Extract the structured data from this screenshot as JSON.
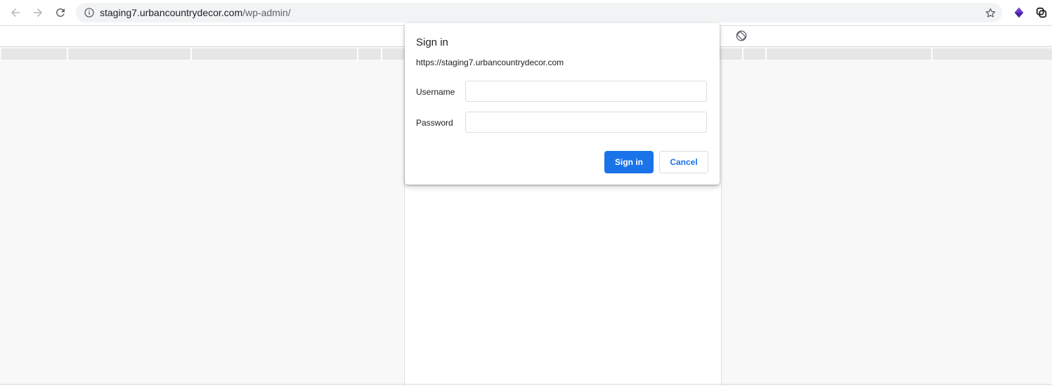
{
  "browser": {
    "url_host": "staging7.urbancountrydecor.com",
    "url_path": "/wp-admin/",
    "icons": {
      "back": "arrow-left",
      "forward": "arrow-right",
      "reload": "reload",
      "site_info": "info-circle",
      "bookmark": "star",
      "extension_1": "purple-diamond",
      "extension_2": "link-loop"
    },
    "colors": {
      "extension_1": "#4a1fa8",
      "accent": "#1a73e8"
    }
  },
  "dialog": {
    "title": "Sign in",
    "origin": "https://staging7.urbancountrydecor.com",
    "username_label": "Username",
    "username_value": "",
    "password_label": "Password",
    "password_value": "",
    "sign_in_label": "Sign in",
    "cancel_label": "Cancel"
  }
}
